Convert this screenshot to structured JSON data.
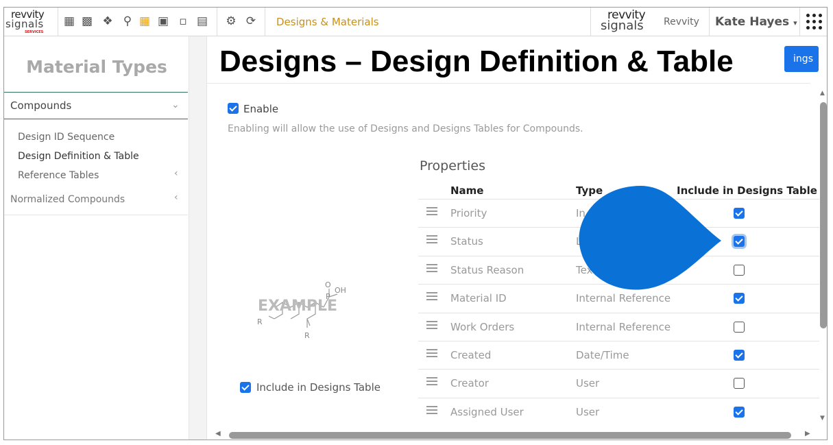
{
  "topbar": {
    "logo_left_line1": "revvity",
    "logo_left_line2": "signals",
    "logo_left_line3": "SERVICES",
    "breadcrumb": "Designs & Materials",
    "logo_right_line1": "revvity",
    "logo_right_line2": "signals",
    "org_label": "Revvity",
    "user_name": "Kate Hayes",
    "user_caret": "▾",
    "icons": [
      "calculator-icon",
      "building-icon",
      "handshake-icon",
      "lightbulb-icon",
      "table-icon",
      "folder-clock-icon",
      "clipboard-icon",
      "document-icon",
      "gear-icon",
      "refresh-icon",
      "apps-grid-icon"
    ]
  },
  "sidebar": {
    "title": "Material Types",
    "section": "Compounds",
    "items": [
      "Design ID Sequence",
      "Design Definition & Table",
      "Reference Tables"
    ],
    "normalized": "Normalized Compounds"
  },
  "main": {
    "title": "Designs – Design Definition & Table",
    "button_label": "ings",
    "enable_label": "Enable",
    "enable_checked": true,
    "enable_description": "Enabling will allow the use of Designs and Designs Tables for Compounds.",
    "example_watermark": "EXAMPLE",
    "molecule_labels": {
      "oh": "OH",
      "p": "P",
      "o": "O",
      "r": "R"
    },
    "include_label": "Include in Designs Table",
    "include_checked": true,
    "properties": {
      "title": "Properties",
      "headers": {
        "name": "Name",
        "type": "Type",
        "include": "Include in Designs Table"
      },
      "rows": [
        {
          "name": "Priority",
          "type": "In",
          "include": true
        },
        {
          "name": "Status",
          "type": "L",
          "include": true
        },
        {
          "name": "Status Reason",
          "type": "Tex",
          "include": false
        },
        {
          "name": "Material ID",
          "type": "Internal Reference",
          "include": true
        },
        {
          "name": "Work Orders",
          "type": "Internal Reference",
          "include": false
        },
        {
          "name": "Created",
          "type": "Date/Time",
          "include": true
        },
        {
          "name": "Creator",
          "type": "User",
          "include": false
        },
        {
          "name": "Assigned User",
          "type": "User",
          "include": true
        }
      ]
    }
  },
  "colors": {
    "accent": "#1a73e8",
    "breadcrumb": "#c8901a",
    "overlay_blob": "#0a72d6"
  }
}
